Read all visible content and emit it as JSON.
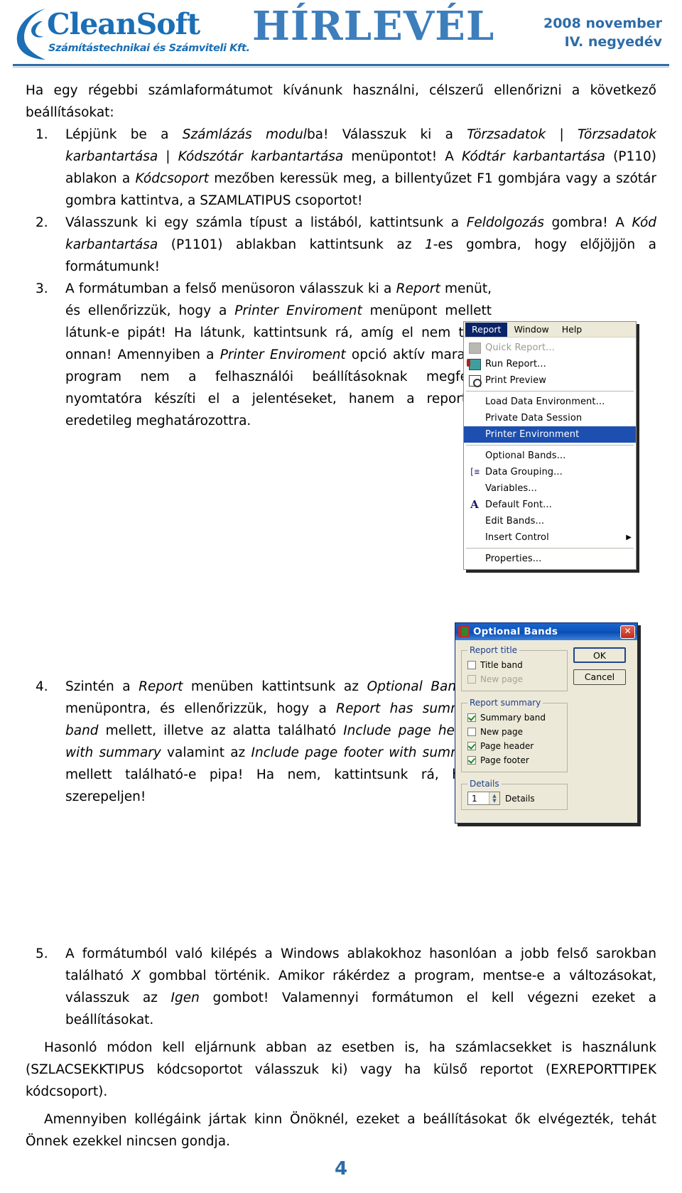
{
  "header": {
    "logo_word": "CleanSoft",
    "logo_sub": "Számítástechnikai és Számviteli Kft.",
    "masthead": "HÍRLEVÉL",
    "issue_line1": "2008 november",
    "issue_line2": "IV. negyedév",
    "brand_color": "#2d6ca8"
  },
  "body": {
    "intro": "Ha egy régebbi számlaformátumot kívánunk használni, célszerű ellenőrizni a következő beállításokat:",
    "step1_num": "1.",
    "step1_a": "Lépjünk be a ",
    "step1_i1": "Számlázás modul",
    "step1_b": "ba! Válasszuk ki a ",
    "step1_i2": "Törzsadatok | Törzsadatok karbantartása | Kódszótár karbantartása",
    "step1_c": " menüpontot! A ",
    "step1_i3": "Kódtár karbantartása",
    "step1_d": " (P110) ablakon a ",
    "step1_i4": "Kódcsoport",
    "step1_e": " mezőben keressük meg, a billentyűzet F1 gombjára vagy a szótár gombra kattintva, a SZAMLATIPUS csoportot!",
    "step2_num": "2.",
    "step2_a": "Válasszunk ki egy számla típust a listából, kattintsunk a ",
    "step2_i1": "Feldolgozás",
    "step2_b": " gombra! A ",
    "step2_i2": "Kód karbantartása",
    "step2_c": " (P1101) ablakban kattintsunk az ",
    "step2_i3": "1",
    "step2_d": "-es gombra, hogy előjöjjön a formátumunk!",
    "step3_num": "3.",
    "step3_a": "A formátumban a felső menüsoron válasszuk ki a ",
    "step3_i1": "Report",
    "step3_b": " menüt, és ellenőrizzük, hogy a ",
    "step3_i2": "Printer Enviroment",
    "step3_c": " menüpont mellett látunk-e pipát! Ha látunk, kattintsunk rá, amíg el nem tűnik onnan! Amennyiben a ",
    "step3_i3": "Printer Enviroment",
    "step3_d": " opció aktív marad, a program nem a felhasználói beállításoknak megfelelő nyomtatóra készíti el a jelentéseket, hanem a reportban eredetileg meghatározottra.",
    "step4_num": "4.",
    "step4_a": "Szintén a ",
    "step4_i1": "Report",
    "step4_b": " menüben kattintsunk az ",
    "step4_i2": "Optional Bands…",
    "step4_c": " menüpontra, és ellenőrizzük, hogy a ",
    "step4_i3": "Report has summary band",
    "step4_d": " mellett, illetve az alatta található ",
    "step4_i4": "Include page header with summary",
    "step4_e": " valamint az ",
    "step4_i5": "Include page footer with summary",
    "step4_f": " mellett található-e pipa! Ha nem, kattintsunk rá, hogy szerepeljen!",
    "step5_num": "5.",
    "step5_a": "A formátumból való kilépés a Windows ablakokhoz hasonlóan a jobb felső sarokban található ",
    "step5_i1": "X",
    "step5_b": " gombbal történik. Amikor rákérdez a program, mentse-e a változásokat, válasszuk az ",
    "step5_i2": "Igen",
    "step5_c": " gombot! Valamennyi formátumon el kell végezni ezeket a beállításokat.",
    "tail1": "Hasonló módon kell eljárnunk abban az esetben is, ha számlacsekket is használunk (SZLACSEKKTIPUS kódcsoportot válasszuk ki) vagy ha külső reportot (EXREPORTTIPEK kódcsoport).",
    "tail2": "Amennyiben kollégáink jártak kinn Önöknél, ezeket a beállításokat ők elvégezték, tehát Önnek ezekkel nincsen gondja."
  },
  "menu_shot": {
    "menubar": [
      {
        "label": "Report",
        "selected": true
      },
      {
        "label": "Window",
        "selected": false
      },
      {
        "label": "Help",
        "selected": false
      }
    ],
    "items": [
      {
        "label": "Quick Report...",
        "icon": "quick-report-icon",
        "disabled": true,
        "highlighted": false,
        "separator_after": false
      },
      {
        "label": "Run Report...",
        "icon": "run-report-icon",
        "disabled": false,
        "highlighted": false,
        "separator_after": false
      },
      {
        "label": "Print Preview",
        "icon": "print-preview-icon",
        "disabled": false,
        "highlighted": false,
        "separator_after": true
      },
      {
        "label": "Load Data Environment...",
        "icon": "",
        "disabled": false,
        "highlighted": false,
        "separator_after": false
      },
      {
        "label": "Private Data Session",
        "icon": "",
        "disabled": false,
        "highlighted": false,
        "separator_after": false
      },
      {
        "label": "Printer Environment",
        "icon": "",
        "disabled": false,
        "highlighted": true,
        "separator_after": true
      },
      {
        "label": "Optional Bands...",
        "icon": "",
        "disabled": false,
        "highlighted": false,
        "separator_after": false
      },
      {
        "label": "Data Grouping...",
        "icon": "data-grouping-icon",
        "disabled": false,
        "highlighted": false,
        "separator_after": false
      },
      {
        "label": "Variables...",
        "icon": "",
        "disabled": false,
        "highlighted": false,
        "separator_after": false
      },
      {
        "label": "Default Font...",
        "icon": "font-icon",
        "disabled": false,
        "highlighted": false,
        "separator_after": false
      },
      {
        "label": "Edit Bands...",
        "icon": "",
        "disabled": false,
        "highlighted": false,
        "separator_after": false
      },
      {
        "label": "Insert Control",
        "icon": "",
        "disabled": false,
        "highlighted": false,
        "submenu": true,
        "separator_after": true
      },
      {
        "label": "Properties...",
        "icon": "",
        "disabled": false,
        "highlighted": false,
        "separator_after": false
      }
    ],
    "submenu_arrow": "▶"
  },
  "dialog": {
    "title": "Optional Bands",
    "close_label": "✕",
    "group_title": "Report title",
    "group_summary": "Report summary",
    "group_details": "Details",
    "title_band": {
      "label": "Title band",
      "checked": false,
      "disabled": false
    },
    "title_new_page": {
      "label": "New page",
      "checked": false,
      "disabled": true
    },
    "summary_band": {
      "label": "Summary band",
      "checked": true,
      "disabled": false
    },
    "summary_new_page": {
      "label": "New page",
      "checked": false,
      "disabled": false
    },
    "page_header": {
      "label": "Page header",
      "checked": true,
      "disabled": false
    },
    "page_footer": {
      "label": "Page footer",
      "checked": true,
      "disabled": false
    },
    "details_value": "1",
    "details_label": "Details",
    "ok_label": "OK",
    "cancel_label": "Cancel"
  },
  "footer": {
    "page_number": "4"
  }
}
